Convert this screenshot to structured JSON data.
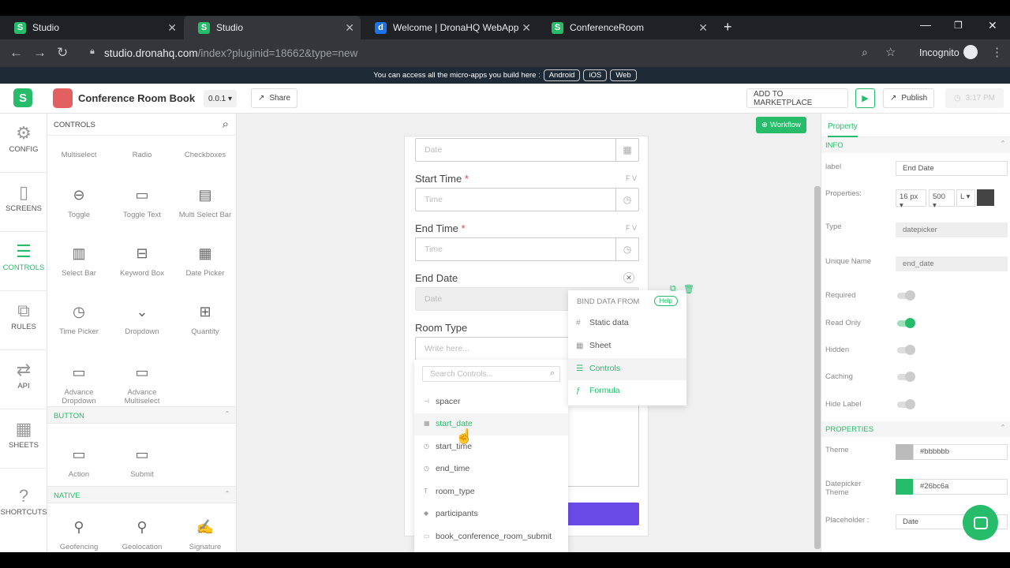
{
  "browser": {
    "tabs": [
      {
        "title": "Studio",
        "icon": "S"
      },
      {
        "title": "Studio",
        "icon": "S"
      },
      {
        "title": "Welcome | DronaHQ WebApp",
        "icon": "d"
      },
      {
        "title": "ConferenceRoom",
        "icon": "S"
      }
    ],
    "url_host": "studio.dronahq.com",
    "url_path": "/index?pluginid=18662&type=new",
    "incognito": "Incognito"
  },
  "banner": {
    "text": "You can access all the micro-apps you build here :",
    "links": [
      "Android",
      "iOS",
      "Web"
    ]
  },
  "header": {
    "app_name": "Conference Room Book",
    "version": "0.0.1",
    "share": "Share",
    "marketplace": "ADD TO MARKETPLACE",
    "publish": "Publish",
    "time": "3:17 PM"
  },
  "rail": [
    "CONFIG",
    "SCREENS",
    "CONTROLS",
    "RULES",
    "API",
    "SHEETS",
    "SHORTCUTS"
  ],
  "controls_panel": {
    "title": "CONTROLS",
    "items": [
      "Multiselect",
      "Radio",
      "Checkboxes",
      "Toggle",
      "Toggle Text",
      "Multi Select Bar",
      "Select Bar",
      "Keyword Box",
      "Date Picker",
      "Time Picker",
      "Dropdown",
      "Quantity",
      "Advance Dropdown",
      "Advance Multiselect"
    ],
    "button_section": "BUTTON",
    "button_items": [
      "Action",
      "Submit"
    ],
    "native_section": "NATIVE",
    "native_items": [
      "Geofencing",
      "Geolocation",
      "Signature"
    ]
  },
  "canvas": {
    "workflow": "Workflow",
    "date_placeholder": "Date",
    "start_time_label": "Start Time",
    "end_time_label": "End Time",
    "time_placeholder": "Time",
    "end_date_label": "End Date",
    "room_type_label": "Room Type",
    "write_here": "Write here...",
    "req": "*",
    "fx": "F V"
  },
  "dropdown": {
    "search_placeholder": "Search Controls...",
    "items": [
      "spacer",
      "start_date",
      "start_time",
      "end_time",
      "room_type",
      "participants",
      "book_conference_room_submit"
    ]
  },
  "bind_popup": {
    "title": "BIND DATA FROM",
    "help": "Help",
    "items": [
      "Static data",
      "Sheet",
      "Controls",
      "Formula"
    ]
  },
  "property_panel": {
    "tab": "Property",
    "info_section": "INFO",
    "label_label": "label",
    "label_value": "End Date",
    "properties_label": "Properties:",
    "font_size": "16 px",
    "font_weight": "500",
    "align": "L",
    "type_label": "Type",
    "type_value": "datepicker",
    "unique_label": "Unique Name",
    "unique_value": "end_date",
    "toggles": [
      "Required",
      "Read Only",
      "Hidden",
      "Caching",
      "Hide Label"
    ],
    "read_only_on": true,
    "properties_section": "PROPERTIES",
    "theme_label": "Theme",
    "theme_value": "#bbbbbb",
    "dp_theme_label": "Datepicker Theme",
    "dp_theme_value": "#26bc6a",
    "placeholder_label": "Placeholder :",
    "placeholder_value": "Date"
  },
  "colors": {
    "accent": "#26bc6a",
    "submit_button": "#6a4be8",
    "theme": "#bbbbbb",
    "color_swatch": "#444444"
  }
}
